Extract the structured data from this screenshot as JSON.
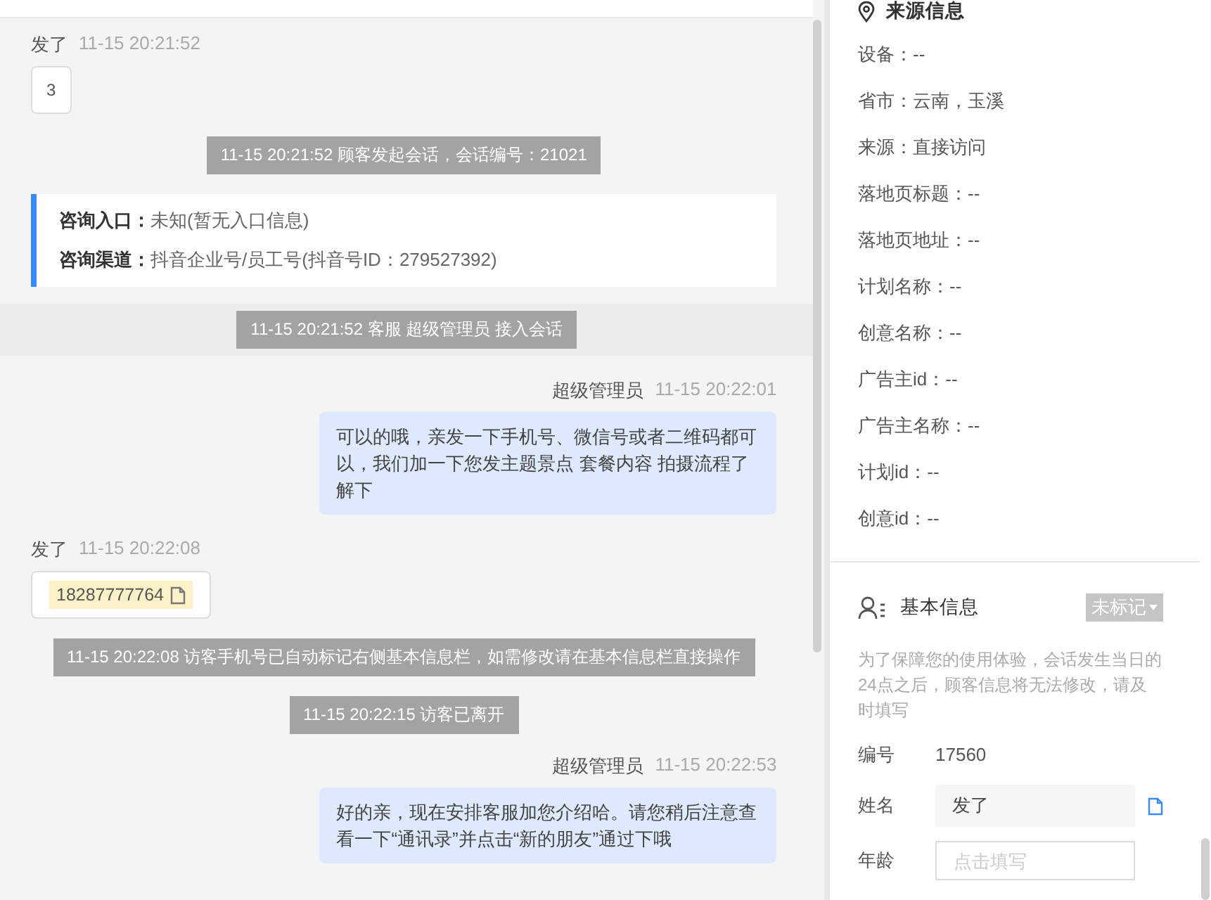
{
  "messages": [
    {
      "kind": "customer",
      "name": "发了",
      "time": "11-15 20:21:52",
      "text": "3"
    },
    {
      "kind": "system",
      "text": "11-15 20:21:52 顾客发起会话，会话编号：21021"
    },
    {
      "kind": "entry",
      "lines": [
        {
          "label": "咨询入口：",
          "value": "未知(暂无入口信息)"
        },
        {
          "label": "咨询渠道：",
          "value": "抖音企业号/员工号(抖音号ID：279527392)"
        }
      ]
    },
    {
      "kind": "band",
      "text": "11-15 20:21:52 客服 超级管理员 接入会话"
    },
    {
      "kind": "agent",
      "name": "超级管理员",
      "time": "11-15 20:22:01",
      "text": "可以的哦，亲发一下手机号、微信号或者二维码都可以，我们加一下您发主题景点 套餐内容 拍摄流程了解下"
    },
    {
      "kind": "phone",
      "name": "发了",
      "time": "11-15 20:22:08",
      "text": "18287777764"
    },
    {
      "kind": "system",
      "text": "11-15 20:22:08 访客手机号已自动标记右侧基本信息栏，如需修改请在基本信息栏直接操作"
    },
    {
      "kind": "system",
      "text": "11-15 20:22:15 访客已离开"
    },
    {
      "kind": "agent",
      "name": "超级管理员",
      "time": "11-15 20:22:53",
      "text": "好的亲，现在安排客服加您介绍哈。请您稍后注意查看一下“通讯录”并点击“新的朋友”通过下哦"
    }
  ],
  "source": {
    "title": "来源信息",
    "items": [
      "设备：--",
      "省市：云南，玉溪",
      "来源：直接访问",
      "落地页标题：--",
      "落地页地址：--",
      "计划名称：--",
      "创意名称：--",
      "广告主id：--",
      "广告主名称：--",
      "计划id：--",
      "创意id：--"
    ]
  },
  "basic": {
    "title": "基本信息",
    "tag": "未标记",
    "notice": "为了保障您的使用体验，会话发生当日的24点之后，顾客信息将无法修改，请及时填写",
    "fields": [
      {
        "kind": "text",
        "label": "编号",
        "value": "17560"
      },
      {
        "kind": "input",
        "label": "姓名",
        "value": "发了"
      },
      {
        "kind": "empty",
        "label": "年龄",
        "placeholder": "点击填写"
      }
    ]
  }
}
